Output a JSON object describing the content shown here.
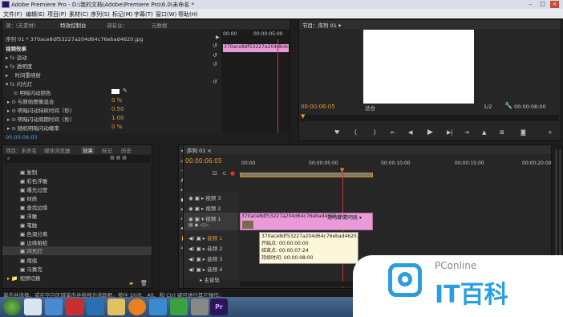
{
  "window": {
    "title": "Adobe Premiere Pro - D:\\我的文档\\Adobe\\Premiere Pro\\6.0\\未命名 *"
  },
  "menu": [
    "文件(F)",
    "编辑(E)",
    "项目(P)",
    "素材(C)",
    "序列(S)",
    "标记(M)",
    "字幕(T)",
    "窗口(W)",
    "帮助(H)"
  ],
  "effect_controls": {
    "tabs": [
      "源：(无素材)",
      "特效控制台",
      "调音台：",
      "元数据"
    ],
    "sequence_label": "序列 01 * 370ace8df53227a204d64c76ebad4620.jpg",
    "ruler_time": "00:00",
    "ruler_time2": "00:00:05:00",
    "clip_name": "370ace8df53227a204d64c76ebad4620.jpg",
    "section": "视频效果",
    "effects": [
      {
        "name": "运动",
        "type": "fx"
      },
      {
        "name": "透明度",
        "type": "fx"
      },
      {
        "name": "时间重映射",
        "type": "plain"
      },
      {
        "name": "闪光灯",
        "type": "fx"
      }
    ],
    "params": [
      {
        "name": "明暗闪动颜色",
        "value": ""
      },
      {
        "name": "与原始图像混合",
        "value": "0 %"
      },
      {
        "name": "明暗闪动持续时间（秒）",
        "value": "0.50"
      },
      {
        "name": "明暗闪动周期时间（秒）",
        "value": "1.00"
      },
      {
        "name": "随机明暗闪动概率",
        "value": "0 %"
      }
    ],
    "timecode": "00:00:06:05"
  },
  "program": {
    "tab": "节目：序列 01 ▾",
    "timecode": "00:00:06:05",
    "fit": "适合",
    "fraction": "1/2",
    "duration": "00:00:08:00"
  },
  "project": {
    "tabs": [
      "项目：未命名",
      "媒体浏览器",
      "效果",
      "标记",
      "历史"
    ],
    "items": [
      "复制",
      "彩色浮雕",
      "曝光过度",
      "材质",
      "查找边缘",
      "浮雕",
      "笔触",
      "色调分离",
      "边缘粗糙",
      "闪光灯",
      "阈值",
      "马赛克"
    ],
    "highlight_index": 9,
    "folder": "视频切换"
  },
  "timeline": {
    "tab": "序列 01 ×",
    "timecode": "00:00:06:05",
    "ruler": [
      "00:00",
      "00:00:05:00",
      "00:00:10:00",
      "00:00:15:00",
      "00:00:20:00"
    ],
    "tracks": [
      {
        "name": "视频 3",
        "kind": "video"
      },
      {
        "name": "视频 2",
        "kind": "video"
      },
      {
        "name": "视频 1",
        "kind": "video"
      },
      {
        "name": "音频 1",
        "kind": "audio"
      },
      {
        "name": "音频 2",
        "kind": "audio"
      },
      {
        "name": "音频 3",
        "kind": "audio"
      },
      {
        "name": "音频 4",
        "kind": "audio"
      },
      {
        "name": "主音轨",
        "kind": "master"
      }
    ],
    "clip_label": "370ace8df53227a204d64c76ebad4620.jpg",
    "clip_tag": "透明度:透明度 ▾",
    "tooltip": {
      "title": "370ace8df53227a204d64c76ebad4620.jpg",
      "start": "开始点: 00:00:00:00",
      "end": "结束点: 00:00:07:24",
      "dur": "持续时间: 00:00:08:00"
    }
  },
  "status": {
    "text": "单击并选择，或在空白区域单击并拖拽为选取框。按住 Shift、Alt、和 Ctrl 键可进行其它操作。"
  },
  "watermark": {
    "brand": "PConline",
    "text": "IT百科"
  },
  "colors": {
    "accent": "#e69a28",
    "clip_pink": "#e89bd8",
    "playhead": "#d03030"
  }
}
